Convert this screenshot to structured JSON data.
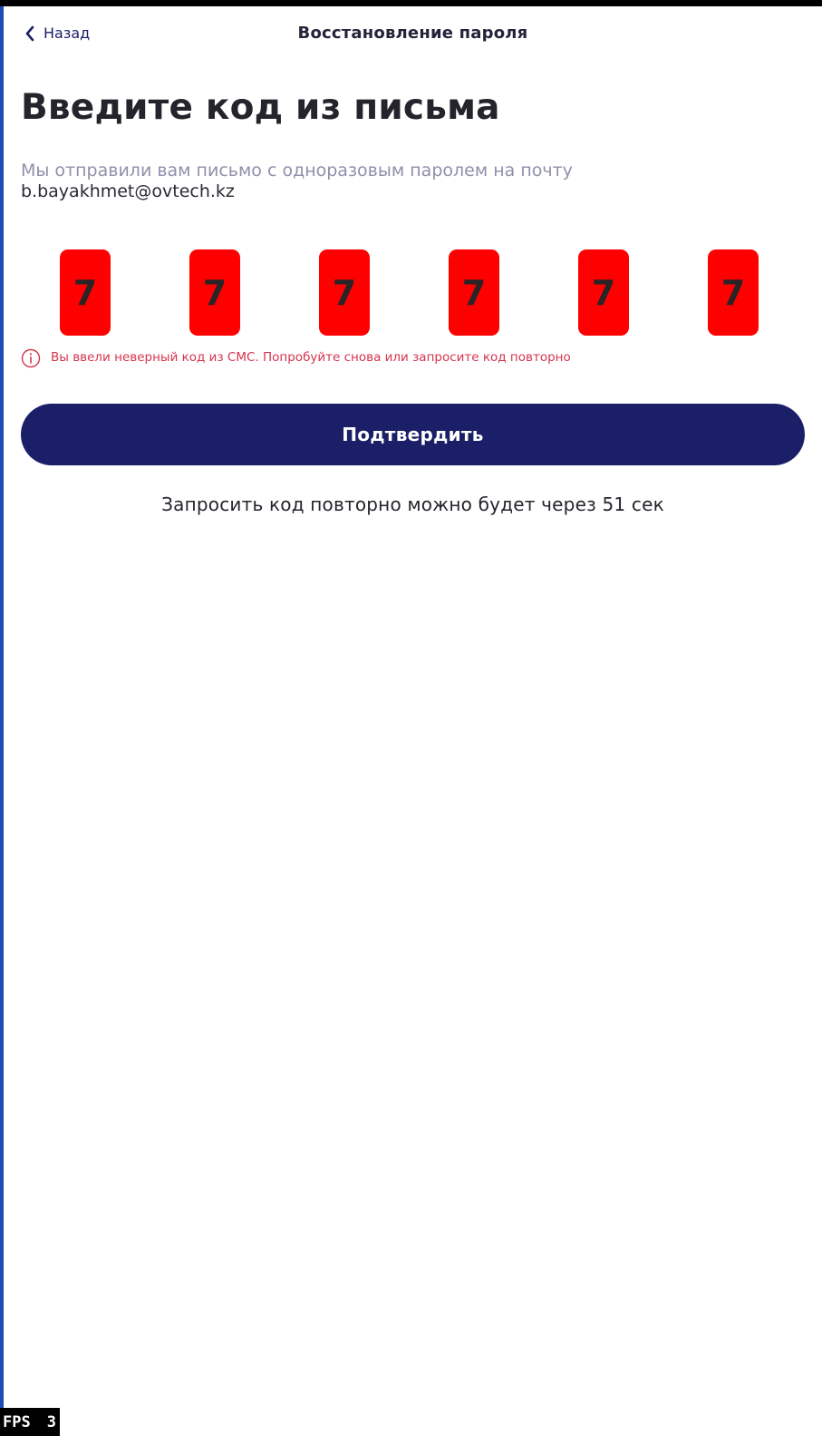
{
  "nav": {
    "back_label": "Назад",
    "title": "Восстановление пароля"
  },
  "main": {
    "heading": "Введите код из письма",
    "description": "Мы отправили вам письмо с одноразовым паролем на почту",
    "email": "b.bayakhmet@ovtech.kz",
    "code_digits": [
      "7",
      "7",
      "7",
      "7",
      "7",
      "7"
    ],
    "error_text": "Вы ввели неверный код из СМС. Попробуйте снова или запросите код повторно",
    "confirm_label": "Подтвердить",
    "resend_text": "Запросить код повторно можно будет через 51 сек"
  },
  "overlay": {
    "fps_label": "FPS",
    "fps_value": "3"
  },
  "icons": {
    "back": "chevron-left-icon",
    "error": "info-circle-icon"
  },
  "colors": {
    "primary": "#1b1f67",
    "code_cell_error": "#ff0000",
    "error_text": "#d6344e",
    "muted_text": "#8f90aa"
  }
}
